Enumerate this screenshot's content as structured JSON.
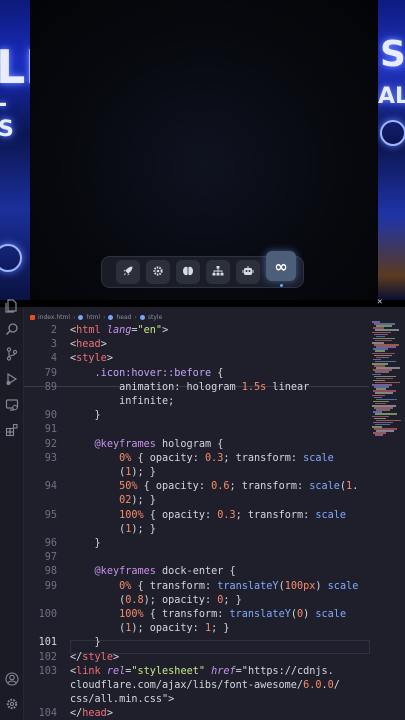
{
  "background": {
    "left_glyph_1": "LE",
    "left_glyph_2": "- S",
    "right_glyph_1": "S",
    "right_glyph_2": "ALL"
  },
  "dock": {
    "buttons": [
      {
        "icon": "rocket-icon",
        "glyph": "🚀"
      },
      {
        "icon": "cog-icon",
        "glyph": "⚙"
      },
      {
        "icon": "brain-icon",
        "glyph": "◕"
      },
      {
        "icon": "sitemap-icon",
        "glyph": "⊞"
      },
      {
        "icon": "robot-icon",
        "glyph": "◘"
      },
      {
        "icon": "infinity-icon",
        "glyph": "∞",
        "active": true
      }
    ]
  },
  "overlay_close": "✕",
  "breadcrumb": {
    "file": "index.html",
    "items": [
      "html",
      "head",
      "style"
    ]
  },
  "editor": {
    "current_line": "101",
    "lines": [
      {
        "n": "2",
        "text": "<html lang=\"en\">"
      },
      {
        "n": "3",
        "text": "<head>"
      },
      {
        "n": "4",
        "text": "    <style>"
      },
      {
        "n": "79",
        "text": "        .icon:hover::before {"
      },
      {
        "n": "89",
        "text": "            animation: hologram 1.5s linear"
      },
      {
        "n": "",
        "text": "            infinite;"
      },
      {
        "n": "90",
        "text": "        }"
      },
      {
        "n": "91",
        "text": ""
      },
      {
        "n": "92",
        "text": "        @keyframes hologram {"
      },
      {
        "n": "93",
        "text": "            0% { opacity: 0.3; transform: scale"
      },
      {
        "n": "",
        "text": "            (1); }"
      },
      {
        "n": "94",
        "text": "            50% { opacity: 0.6; transform: scale(1."
      },
      {
        "n": "",
        "text": "            02); }"
      },
      {
        "n": "95",
        "text": "            100% { opacity: 0.3; transform: scale"
      },
      {
        "n": "",
        "text": "            (1); }"
      },
      {
        "n": "96",
        "text": "        }"
      },
      {
        "n": "97",
        "text": ""
      },
      {
        "n": "98",
        "text": "        @keyframes dock-enter {"
      },
      {
        "n": "99",
        "text": "            0% { transform: translateY(100px) scale"
      },
      {
        "n": "",
        "text": "            (0.8); opacity: 0; }"
      },
      {
        "n": "100",
        "text": "            100% { transform: translateY(0) scale"
      },
      {
        "n": "",
        "text": "            (1); opacity: 1; }"
      },
      {
        "n": "101",
        "text": "        }"
      },
      {
        "n": "102",
        "text": "    </style>"
      },
      {
        "n": "103",
        "text": "    <link rel=\"stylesheet\" href=\"https://cdnjs."
      },
      {
        "n": "",
        "text": "    cloudflare.com/ajax/libs/font-awesome/6.0.0/"
      },
      {
        "n": "",
        "text": "    css/all.min.css\">"
      },
      {
        "n": "104",
        "text": "</head>"
      }
    ]
  },
  "activity_bar": [
    "explorer-icon",
    "search-icon",
    "source-control-icon",
    "run-debug-icon",
    "remote-explorer-icon",
    "extensions-icon",
    "account-icon",
    "settings-gear-icon"
  ],
  "colors": {
    "editor_bg": "#1e1f2a",
    "accent": "#5aa9ff",
    "tag": "#f07178",
    "string": "#c3e88d",
    "number": "#f78c6c"
  }
}
